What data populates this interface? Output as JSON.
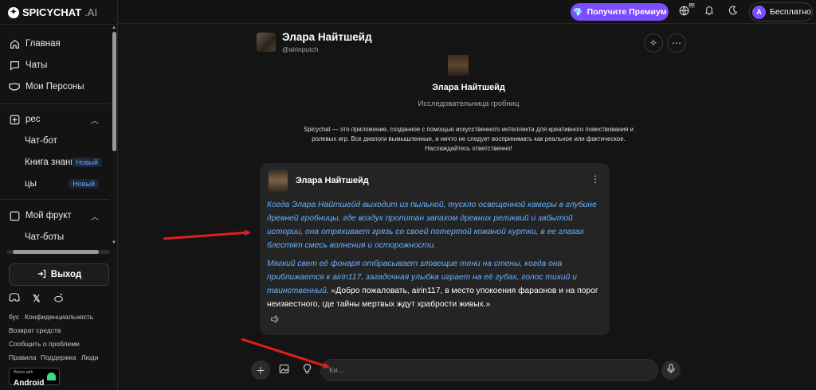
{
  "brand": {
    "name": "SPICYCHAT",
    "suffix": ".AI"
  },
  "sidebar": {
    "main_items": [
      {
        "label": "Главная",
        "icon": "home-icon"
      },
      {
        "label": "Чаты",
        "icon": "chat-icon"
      },
      {
        "label": "Мои Персоны",
        "icon": "mask-icon"
      }
    ],
    "section_create": {
      "label": "рес",
      "icon": "plus-square-icon",
      "items": [
        {
          "label": "Чат-бот"
        },
        {
          "label": "Книга знаний",
          "badge": "Новый"
        },
        {
          "label": "цы",
          "badge": "Новый"
        }
      ]
    },
    "section_fruit": {
      "label": "Мой фрукт",
      "icon": "folder-icon",
      "items": [
        {
          "label": "Чат-боты"
        }
      ]
    },
    "logout_label": "Выход",
    "footer_links": [
      "бус",
      "Конфиденциальность",
      "Возврат средств",
      "Сообщить о проблеме",
      "Правила",
      "Поддержка",
      "Люди"
    ],
    "android_badge": {
      "small": "Works with",
      "big": "Android"
    }
  },
  "topbar": {
    "premium_label": "Получите Премиум",
    "language_badge": "РУ",
    "account": {
      "initial": "A",
      "label": "Бесплатно"
    }
  },
  "chat": {
    "name": "Элара Найтшейд",
    "handle": "@airinputch",
    "subtitle": "Исследовательница гробниц",
    "disclaimer": "Spicychat — это приложение, созданное с помощью искусственного интеллекта для креативного повествования и ролевых игр. Все диалоги вымышленные, и ничто не следует воспринимать как реальное или фактическое. Наслаждайтесь ответственно!",
    "message": {
      "author": "Элара Найтшейд",
      "para1": "Когда Элара Найтшейд выходит из пыльной, тускло освещенной камеры в глубине древней гробницы, где воздух пропитан запахом древних реликвий и забытой истории, она отряхивает грязь со своей потертой кожаной куртки, в ее глазах блестят смесь волнения и осторожности.",
      "para2_action": "Мягкий свет её фонаря отбрасывает зловещие тени на стены, когда она приближается к airin117, загадочная улыбка играет на её губах, голос тихий и таинственный.",
      "para2_speech": " «Добро пожаловать, airin117, в место упокоения фараонов и на порог неизвестного, где тайны мертвых ждут храбрости живых.»"
    },
    "input_placeholder": "Ки..."
  },
  "colors": {
    "accent": "#7c4dff",
    "action_text": "#6ab3ff",
    "badge": "#6aa2ff",
    "annotation_arrow": "#e01e1e"
  }
}
